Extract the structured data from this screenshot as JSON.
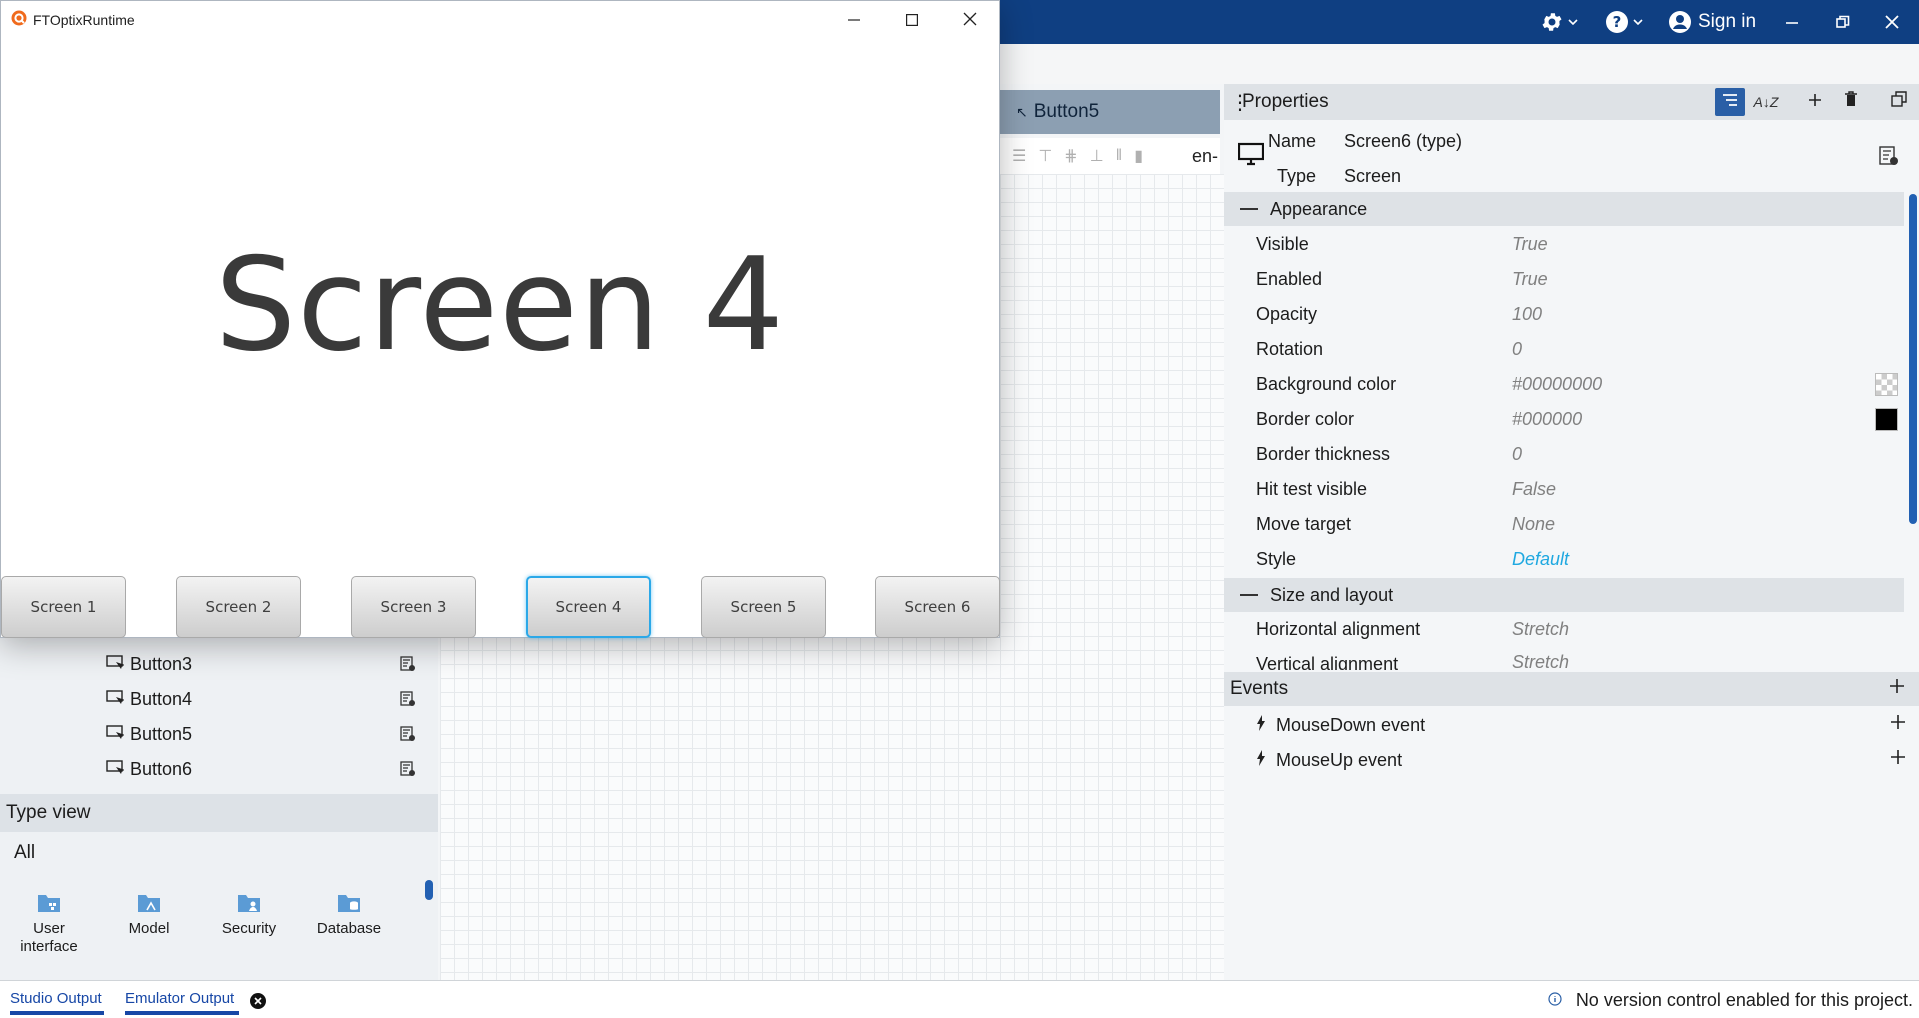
{
  "appbar": {
    "sign_in": "Sign in",
    "icons": [
      "gear-icon",
      "help-icon",
      "account-icon",
      "minimize-icon",
      "restore-icon",
      "close-icon"
    ]
  },
  "editor": {
    "tab_label": "Button5",
    "language": "en-"
  },
  "tree": {
    "items": [
      {
        "label": "Button3"
      },
      {
        "label": "Button4"
      },
      {
        "label": "Button5"
      },
      {
        "label": "Button6"
      }
    ]
  },
  "type_view": {
    "header": "Type view",
    "filter": "All",
    "items": [
      {
        "label": "User interface"
      },
      {
        "label": "Model"
      },
      {
        "label": "Security"
      },
      {
        "label": "Database"
      }
    ]
  },
  "properties": {
    "title": "Properties",
    "name_label": "Name",
    "name_value": "Screen6 (type)",
    "type_label": "Type",
    "type_value": "Screen",
    "appearance_header": "Appearance",
    "appearance": [
      {
        "label": "Visible",
        "value": "True"
      },
      {
        "label": "Enabled",
        "value": "True"
      },
      {
        "label": "Opacity",
        "value": "100"
      },
      {
        "label": "Rotation",
        "value": "0"
      },
      {
        "label": "Background color",
        "value": "#00000000"
      },
      {
        "label": "Border color",
        "value": "#000000"
      },
      {
        "label": "Border thickness",
        "value": "0"
      },
      {
        "label": "Hit test visible",
        "value": "False"
      },
      {
        "label": "Move target",
        "value": "None"
      },
      {
        "label": "Style",
        "value": "Default"
      }
    ],
    "size_header": "Size and layout",
    "size_layout": [
      {
        "label": "Horizontal alignment",
        "value": "Stretch"
      },
      {
        "label": "Vertical alignment",
        "value": "Stretch"
      }
    ],
    "events_header": "Events",
    "events": [
      {
        "label": "MouseDown event"
      },
      {
        "label": "MouseUp event"
      }
    ]
  },
  "status": {
    "tab_studio": "Studio Output",
    "tab_emulator": "Emulator Output",
    "message": "No version control enabled for this project."
  },
  "runtime": {
    "window_title": "FTOptixRuntime",
    "screen_title": "Screen 4",
    "buttons": [
      {
        "label": "Screen 1"
      },
      {
        "label": "Screen 2"
      },
      {
        "label": "Screen 3"
      },
      {
        "label": "Screen 4",
        "active": true
      },
      {
        "label": "Screen 5"
      },
      {
        "label": "Screen 6"
      }
    ]
  },
  "colors": {
    "appbar": "#0f3f82",
    "accent": "#2a5fa6",
    "link": "#1fa8e0",
    "active_button_border": "#2ba8e8"
  }
}
